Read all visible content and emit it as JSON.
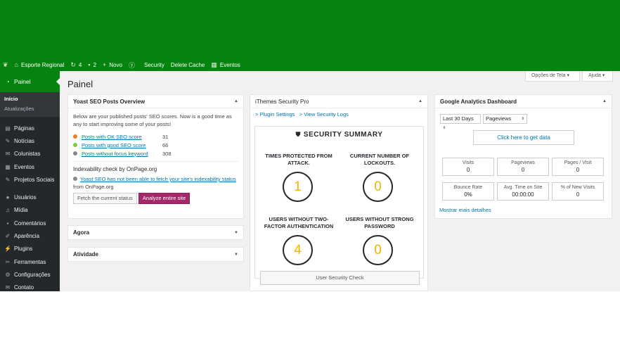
{
  "adminbar": {
    "site_name": "Esporte Regional",
    "updates_count": "4",
    "comments_count": "2",
    "new_label": "Novo",
    "security_label": "Security",
    "delete_cache_label": "Delete Cache",
    "events_label": "Eventos"
  },
  "sidebar": {
    "active_label": "Painel",
    "submenu": [
      "Início",
      "Atualizações"
    ],
    "group1": [
      "Páginas",
      "Notícias",
      "Colunistas",
      "Eventos",
      "Projetos Sociais"
    ],
    "group2": [
      "Usuários",
      "Mídia",
      "Comentários",
      "Aparência",
      "Plugins",
      "Ferramentas",
      "Configurações",
      "Contato"
    ]
  },
  "header": {
    "screen_options": "Opções de Tela ▾",
    "help": "Ajuda ▾",
    "page_title": "Painel"
  },
  "yoast": {
    "title": "Yoast SEO Posts Overview",
    "intro": "Below are your published posts' SEO scores. Now is a good time as any to start improving some of your posts!",
    "scores": [
      {
        "label": "Posts with OK SEO score",
        "count": "31",
        "color": "#ee7c1b"
      },
      {
        "label": "Posts with good SEO score",
        "count": "66",
        "color": "#7ad03a"
      },
      {
        "label": "Posts without focus keyword",
        "count": "308",
        "color": "#888888"
      }
    ],
    "indexability_title": "Indexability check by OnPage.org",
    "indexability_link": "Yoast SEO has not been able to fetch your site's indexability status",
    "indexability_suffix": "from OnPage.org",
    "fetch_button": "Fetch the current status",
    "analyze_button": "Analyze entire site"
  },
  "agora": {
    "title": "Agora"
  },
  "atividade": {
    "title": "Atividade"
  },
  "ithemes": {
    "title": "iThemes Security Pro",
    "plugin_settings": "> Plugin Settings",
    "view_logs": "> View Security Logs",
    "summary_title": "SECURITY SUMMARY",
    "stats": [
      {
        "label": "TIMES PROTECTED FROM ATTACK.",
        "value": "1"
      },
      {
        "label": "CURRENT NUMBER OF LOCKOUTS.",
        "value": "0"
      },
      {
        "label": "USERS WITHOUT TWO-FACTOR AUTHENTICATION",
        "value": "4"
      },
      {
        "label": "USERS WITHOUT STRONG PASSWORD",
        "value": "0"
      }
    ],
    "check_button": "User Security Check"
  },
  "ga": {
    "title": "Google Analytics Dashboard",
    "period": "Last 30 Days",
    "metric_select": "Pageviews",
    "get_data": "Click here to get data",
    "metrics": [
      {
        "label": "Visits",
        "value": "0"
      },
      {
        "label": "Pageviews",
        "value": "0"
      },
      {
        "label": "Pages / Visit",
        "value": "0"
      },
      {
        "label": "Bounce Rate",
        "value": "0%"
      },
      {
        "label": "Avg. Time on Site",
        "value": "00:00:00"
      },
      {
        "label": "% of New Visits",
        "value": "0"
      }
    ],
    "more_link": "Mostrar mais detalhes"
  }
}
